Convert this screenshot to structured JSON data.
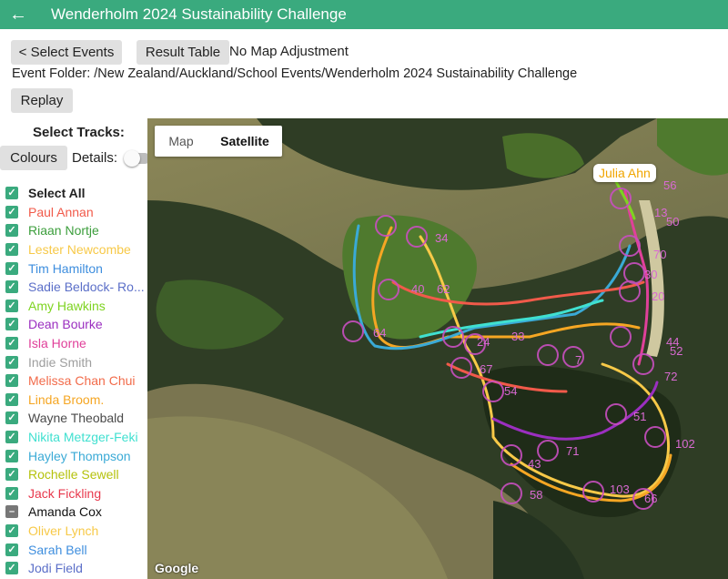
{
  "header": {
    "title": "Wenderholm 2024 Sustainability Challenge"
  },
  "toolbar": {
    "select_events_label": "< Select Events",
    "result_table_label": "Result Table",
    "map_adjustment_text": "No Map Adjustment",
    "event_folder_text": "Event Folder: /New Zealand/Auckland/School Events/Wenderholm 2024 Sustainability Challenge",
    "replay_label": "Replay"
  },
  "sidebar": {
    "title": "Select Tracks:",
    "colours_label": "Colours",
    "details_label": "Details:",
    "details_on": false,
    "select_all_label": "Select All",
    "tracks": [
      {
        "name": "Paul Annan",
        "color": "#f15a4a",
        "checked": true
      },
      {
        "name": "Riaan Nortje",
        "color": "#3c9e3c",
        "checked": true
      },
      {
        "name": "Lester Newcombe",
        "color": "#f7c948",
        "checked": true
      },
      {
        "name": "Tim Hamilton",
        "color": "#3e8ede",
        "checked": true
      },
      {
        "name": "Sadie Beldock- Ro...",
        "color": "#5b6fc8",
        "checked": true
      },
      {
        "name": "Amy Hawkins",
        "color": "#7ed321",
        "checked": true
      },
      {
        "name": "Dean Bourke",
        "color": "#9b2fc0",
        "checked": true
      },
      {
        "name": "Isla Horne",
        "color": "#e0409a",
        "checked": true
      },
      {
        "name": "Indie Smith",
        "color": "#9e9e9e",
        "checked": true
      },
      {
        "name": "Melissa Chan Chui",
        "color": "#f26b4a",
        "checked": true
      },
      {
        "name": "Linda Broom.",
        "color": "#f5a623",
        "checked": true
      },
      {
        "name": "Wayne Theobald",
        "color": "#4a4a4a",
        "checked": true
      },
      {
        "name": "Nikita Metzger-Feki",
        "color": "#40e0d0",
        "checked": true
      },
      {
        "name": "Hayley Thompson",
        "color": "#3aaad6",
        "checked": true
      },
      {
        "name": "Rochelle Sewell",
        "color": "#b5c20c",
        "checked": true
      },
      {
        "name": "Jack Fickling",
        "color": "#e8394d",
        "checked": true
      },
      {
        "name": "Amanda Cox",
        "color": "#111111",
        "checked": false
      },
      {
        "name": "Oliver Lynch",
        "color": "#f7c948",
        "checked": true
      },
      {
        "name": "Sarah Bell",
        "color": "#3e8ede",
        "checked": true
      },
      {
        "name": "Jodi Field",
        "color": "#5b6fc8",
        "checked": true
      }
    ]
  },
  "map": {
    "type_map_label": "Map",
    "type_satellite_label": "Satellite",
    "selected_type": "Satellite",
    "attribution": "Google",
    "tooltip_text": "Julia Ahn",
    "control_labels": [
      "56",
      "13",
      "50",
      "34",
      "70",
      "30",
      "20",
      "64",
      "33",
      "24",
      "44",
      "52",
      "72",
      "54",
      "51",
      "71",
      "102",
      "43",
      "58",
      "103",
      "66",
      "67",
      "7",
      "62",
      "40"
    ]
  }
}
